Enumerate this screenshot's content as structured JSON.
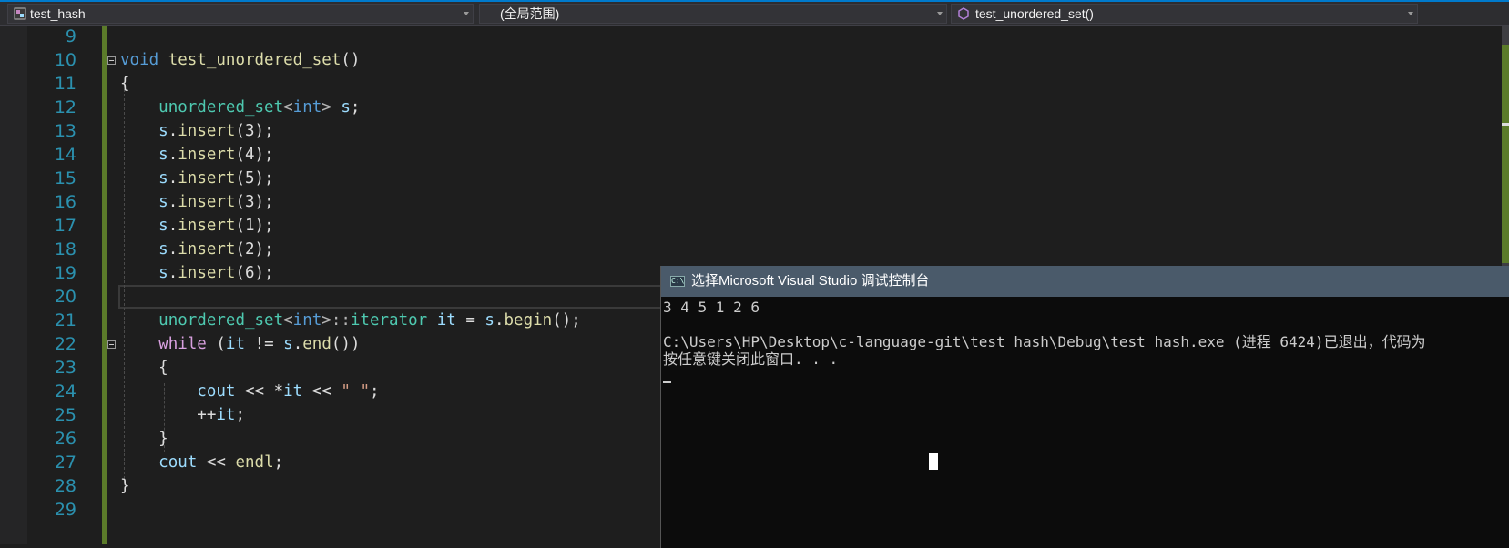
{
  "nav": {
    "project": "test_hash",
    "scope": "(全局范围)",
    "member": "test_unordered_set()"
  },
  "editor": {
    "lines": [
      {
        "num": "9",
        "tokens": []
      },
      {
        "num": "10",
        "tokens": [
          {
            "t": "void",
            "c": "kw"
          },
          {
            "t": " ",
            "c": ""
          },
          {
            "t": "test_unordered_set",
            "c": "fn"
          },
          {
            "t": "()",
            "c": ""
          }
        ]
      },
      {
        "num": "11",
        "tokens": [
          {
            "t": "{",
            "c": ""
          }
        ]
      },
      {
        "num": "12",
        "tokens": [
          {
            "t": "    ",
            "c": ""
          },
          {
            "t": "unordered_set",
            "c": "ty"
          },
          {
            "t": "<",
            "c": "op"
          },
          {
            "t": "int",
            "c": "kw"
          },
          {
            "t": "> ",
            "c": "op"
          },
          {
            "t": "s",
            "c": "vr"
          },
          {
            "t": ";",
            "c": ""
          }
        ]
      },
      {
        "num": "13",
        "tokens": [
          {
            "t": "    ",
            "c": ""
          },
          {
            "t": "s",
            "c": "vr"
          },
          {
            "t": ".",
            "c": ""
          },
          {
            "t": "insert",
            "c": "fn"
          },
          {
            "t": "(3);",
            "c": ""
          }
        ]
      },
      {
        "num": "14",
        "tokens": [
          {
            "t": "    ",
            "c": ""
          },
          {
            "t": "s",
            "c": "vr"
          },
          {
            "t": ".",
            "c": ""
          },
          {
            "t": "insert",
            "c": "fn"
          },
          {
            "t": "(4);",
            "c": ""
          }
        ]
      },
      {
        "num": "15",
        "tokens": [
          {
            "t": "    ",
            "c": ""
          },
          {
            "t": "s",
            "c": "vr"
          },
          {
            "t": ".",
            "c": ""
          },
          {
            "t": "insert",
            "c": "fn"
          },
          {
            "t": "(5);",
            "c": ""
          }
        ]
      },
      {
        "num": "16",
        "tokens": [
          {
            "t": "    ",
            "c": ""
          },
          {
            "t": "s",
            "c": "vr"
          },
          {
            "t": ".",
            "c": ""
          },
          {
            "t": "insert",
            "c": "fn"
          },
          {
            "t": "(3);",
            "c": ""
          }
        ]
      },
      {
        "num": "17",
        "tokens": [
          {
            "t": "    ",
            "c": ""
          },
          {
            "t": "s",
            "c": "vr"
          },
          {
            "t": ".",
            "c": ""
          },
          {
            "t": "insert",
            "c": "fn"
          },
          {
            "t": "(1);",
            "c": ""
          }
        ]
      },
      {
        "num": "18",
        "tokens": [
          {
            "t": "    ",
            "c": ""
          },
          {
            "t": "s",
            "c": "vr"
          },
          {
            "t": ".",
            "c": ""
          },
          {
            "t": "insert",
            "c": "fn"
          },
          {
            "t": "(2);",
            "c": ""
          }
        ]
      },
      {
        "num": "19",
        "tokens": [
          {
            "t": "    ",
            "c": ""
          },
          {
            "t": "s",
            "c": "vr"
          },
          {
            "t": ".",
            "c": ""
          },
          {
            "t": "insert",
            "c": "fn"
          },
          {
            "t": "(6);",
            "c": ""
          }
        ]
      },
      {
        "num": "20",
        "tokens": []
      },
      {
        "num": "21",
        "tokens": [
          {
            "t": "    ",
            "c": ""
          },
          {
            "t": "unordered_set",
            "c": "ty"
          },
          {
            "t": "<",
            "c": "op"
          },
          {
            "t": "int",
            "c": "kw"
          },
          {
            "t": ">::",
            "c": "op"
          },
          {
            "t": "iterator",
            "c": "ty"
          },
          {
            "t": " ",
            "c": ""
          },
          {
            "t": "it",
            "c": "vr"
          },
          {
            "t": " = ",
            "c": ""
          },
          {
            "t": "s",
            "c": "vr"
          },
          {
            "t": ".",
            "c": ""
          },
          {
            "t": "begin",
            "c": "fn"
          },
          {
            "t": "();",
            "c": ""
          }
        ]
      },
      {
        "num": "22",
        "tokens": [
          {
            "t": "    ",
            "c": ""
          },
          {
            "t": "while",
            "c": "ctl"
          },
          {
            "t": " (",
            "c": ""
          },
          {
            "t": "it",
            "c": "vr"
          },
          {
            "t": " != ",
            "c": ""
          },
          {
            "t": "s",
            "c": "vr"
          },
          {
            "t": ".",
            "c": ""
          },
          {
            "t": "end",
            "c": "fn"
          },
          {
            "t": "())",
            "c": ""
          }
        ]
      },
      {
        "num": "23",
        "tokens": [
          {
            "t": "    {",
            "c": ""
          }
        ]
      },
      {
        "num": "24",
        "tokens": [
          {
            "t": "        ",
            "c": ""
          },
          {
            "t": "cout",
            "c": "vr"
          },
          {
            "t": " << *",
            "c": ""
          },
          {
            "t": "it",
            "c": "vr"
          },
          {
            "t": " << ",
            "c": ""
          },
          {
            "t": "\" \"",
            "c": "st"
          },
          {
            "t": ";",
            "c": ""
          }
        ]
      },
      {
        "num": "25",
        "tokens": [
          {
            "t": "        ++",
            "c": ""
          },
          {
            "t": "it",
            "c": "vr"
          },
          {
            "t": ";",
            "c": ""
          }
        ]
      },
      {
        "num": "26",
        "tokens": [
          {
            "t": "    }",
            "c": ""
          }
        ]
      },
      {
        "num": "27",
        "tokens": [
          {
            "t": "    ",
            "c": ""
          },
          {
            "t": "cout",
            "c": "vr"
          },
          {
            "t": " << ",
            "c": ""
          },
          {
            "t": "endl",
            "c": "fn"
          },
          {
            "t": ";",
            "c": ""
          }
        ]
      },
      {
        "num": "28",
        "tokens": [
          {
            "t": "}",
            "c": ""
          }
        ]
      },
      {
        "num": "29",
        "tokens": []
      }
    ]
  },
  "console": {
    "title": "选择Microsoft Visual Studio 调试控制台",
    "icon_text": "C:\\",
    "output": "3 4 5 1 2 6",
    "exit_message": "C:\\Users\\HP\\Desktop\\c-language-git\\test_hash\\Debug\\test_hash.exe (进程 6424)已退出，代码为",
    "prompt": "按任意键关闭此窗口. . ."
  }
}
